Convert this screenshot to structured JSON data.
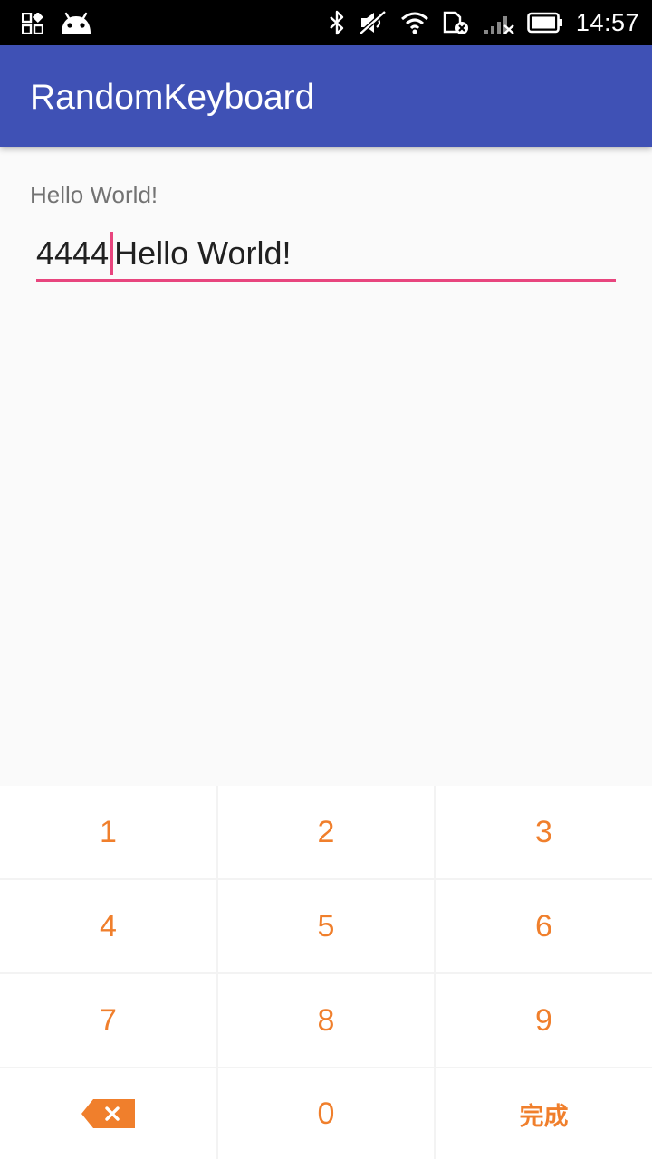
{
  "status_bar": {
    "time": "14:57",
    "icons_left": [
      "apps-grid-icon",
      "android-icon"
    ],
    "icons_right": [
      "bluetooth-icon",
      "sound-off-icon",
      "wifi-icon",
      "no-sim-icon",
      "signal-icon",
      "battery-icon"
    ]
  },
  "app_bar": {
    "title": "RandomKeyboard",
    "color": "#3f51b5"
  },
  "main": {
    "label": "Hello World!",
    "input": {
      "text_before_cursor": "4444",
      "text_after_cursor": "Hello World!",
      "underline_color": "#e8457e"
    }
  },
  "keyboard": {
    "key_color": "#f07f2c",
    "keys": [
      "1",
      "2",
      "3",
      "4",
      "5",
      "6",
      "7",
      "8",
      "9"
    ],
    "zero": "0",
    "done": "完成",
    "backspace_icon": "backspace-icon"
  }
}
